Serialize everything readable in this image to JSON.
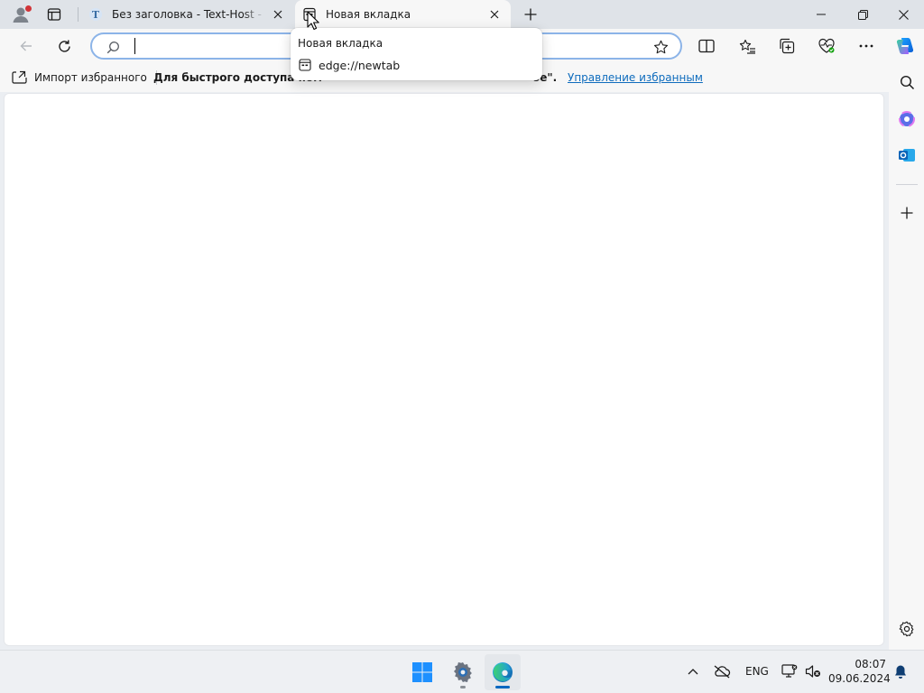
{
  "tabs": [
    {
      "title": "Без заголовка - Text-Host - текстовый редактор",
      "favicon": "text-host-icon",
      "active": false
    },
    {
      "title": "Новая вкладка",
      "favicon": "newtab-page-icon",
      "active": true
    }
  ],
  "addressbar": {
    "value": "",
    "placeholder": ""
  },
  "favorites_bar": {
    "import_label": "Импорт избранного",
    "hint_head": "Для быстрого доступа пом",
    "hint_tail": "ое\".",
    "manage_link": "Управление избранным"
  },
  "hover_card": {
    "title": "Новая вкладка",
    "url": "edge://newtab"
  },
  "taskbar": {
    "apps": [
      "start-icon",
      "settings-icon",
      "edge-icon"
    ],
    "active_app": "edge-icon",
    "language": "ENG",
    "time": "08:07",
    "date": "09.06.2024"
  },
  "colors": {
    "accent": "#0067c0",
    "link": "#0f6cbd",
    "notification_dot": "#d13438",
    "address_border": "#8cb4e8"
  }
}
